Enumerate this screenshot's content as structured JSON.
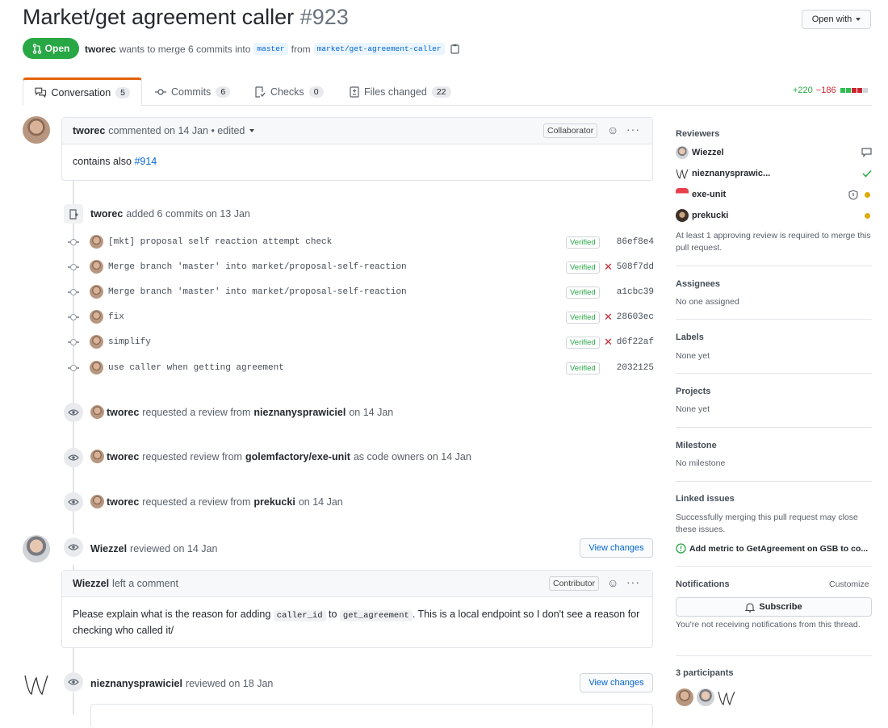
{
  "header": {
    "title": "Market/get agreement caller",
    "number": "#923",
    "open_with": "Open with",
    "state": "Open",
    "author": "tworec",
    "merge_text": "wants to merge 6 commits into",
    "base_branch": "master",
    "from_text": "from",
    "head_branch": "market/get-agreement-caller"
  },
  "tabs": [
    {
      "label": "Conversation",
      "count": "5"
    },
    {
      "label": "Commits",
      "count": "6"
    },
    {
      "label": "Checks",
      "count": "0"
    },
    {
      "label": "Files changed",
      "count": "22"
    }
  ],
  "diffstat": {
    "additions": "+220",
    "deletions": "−186"
  },
  "first_comment": {
    "author": "tworec",
    "meta": "commented on 14 Jan • edited",
    "role": "Collaborator",
    "body_prefix": "contains also",
    "body_link": "#914"
  },
  "commits_event": {
    "author": "tworec",
    "text": "added 6 commits on 13 Jan",
    "verified_label": "Verified",
    "commits": [
      {
        "message": "[mkt] proposal self reaction attempt check",
        "sha": "86ef8e4",
        "failed": false
      },
      {
        "message": "Merge branch 'master' into market/proposal-self-reaction",
        "sha": "508f7dd",
        "failed": true
      },
      {
        "message": "Merge branch 'master' into market/proposal-self-reaction",
        "sha": "a1cbc39",
        "failed": false
      },
      {
        "message": "fix",
        "sha": "28603ec",
        "failed": true
      },
      {
        "message": "simplify",
        "sha": "d6f22af",
        "failed": true
      },
      {
        "message": "use caller when getting agreement",
        "sha": "2032125",
        "failed": false
      }
    ]
  },
  "review_requests": [
    {
      "author": "tworec",
      "pre": "requested a review from",
      "target": "nieznanysprawiciel",
      "post": "on 14 Jan"
    },
    {
      "author": "tworec",
      "pre": "requested review from",
      "target": "golemfactory/exe-unit",
      "post": "as code owners on 14 Jan"
    },
    {
      "author": "tworec",
      "pre": "requested a review from",
      "target": "prekucki",
      "post": "on 14 Jan"
    }
  ],
  "review1": {
    "author": "Wiezzel",
    "text": "reviewed on 14 Jan",
    "view_changes": "View changes",
    "comment_author": "Wiezzel",
    "comment_meta": "left a comment",
    "role": "Contributor",
    "body_1": "Please explain what is the reason for adding",
    "code_1": "caller_id",
    "body_2": "to",
    "code_2": "get_agreement",
    "body_3": ". This is a local endpoint so I don't see a reason for checking who called it/"
  },
  "review2": {
    "author": "nieznanysprawiciel",
    "text": "reviewed on 18 Jan",
    "view_changes": "View changes"
  },
  "sidebar": {
    "reviewers_title": "Reviewers",
    "reviewers": [
      {
        "name": "Wiezzel",
        "status": "comment"
      },
      {
        "name": "nieznanysprawic...",
        "status": "approved"
      },
      {
        "name": "exe-unit",
        "status": "pending"
      },
      {
        "name": "prekucki",
        "status": "pending"
      }
    ],
    "review_note": "At least 1 approving review is required to merge this pull request.",
    "assignees_title": "Assignees",
    "assignees_value": "No one assigned",
    "labels_title": "Labels",
    "labels_value": "None yet",
    "projects_title": "Projects",
    "projects_value": "None yet",
    "milestone_title": "Milestone",
    "milestone_value": "No milestone",
    "linked_title": "Linked issues",
    "linked_desc": "Successfully merging this pull request may close these issues.",
    "linked_issue": "Add metric to GetAgreement on GSB to co...",
    "notifications_title": "Notifications",
    "customize": "Customize",
    "subscribe": "Subscribe",
    "notif_text": "You're not receiving notifications from this thread.",
    "participants_title": "3 participants"
  },
  "colors": {
    "open_green": "#28a745",
    "link_blue": "#0366d6",
    "fail_red": "#cb2431",
    "pending_yellow": "#dbab09"
  }
}
